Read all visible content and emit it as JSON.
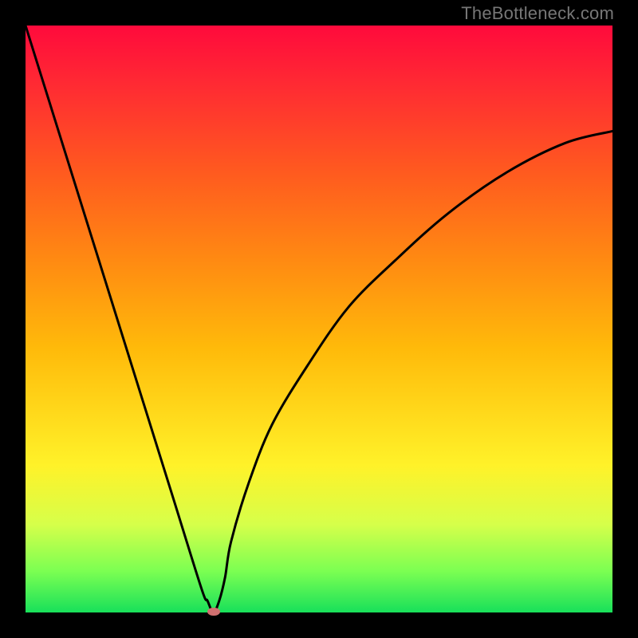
{
  "watermark": "TheBottleneck.com",
  "colors": {
    "frame_bg": "#000000",
    "gradient_top": "#ff0a3c",
    "gradient_bottom": "#18e05a",
    "curve": "#000000",
    "marker": "#d07070"
  },
  "chart_data": {
    "type": "line",
    "title": "",
    "xlabel": "",
    "ylabel": "",
    "xlim": [
      0,
      100
    ],
    "ylim": [
      0,
      100
    ],
    "grid": false,
    "legend": false,
    "series": [
      {
        "name": "curve",
        "x": [
          0,
          5,
          10,
          15,
          20,
          25,
          30,
          31,
          32,
          33,
          34,
          35,
          38,
          42,
          48,
          55,
          63,
          72,
          82,
          92,
          100
        ],
        "values": [
          100,
          84,
          68,
          52,
          36,
          20,
          4,
          2,
          0,
          2,
          6,
          12,
          22,
          32,
          42,
          52,
          60,
          68,
          75,
          80,
          82
        ]
      }
    ],
    "marker": {
      "x": 32,
      "y": 0
    }
  }
}
